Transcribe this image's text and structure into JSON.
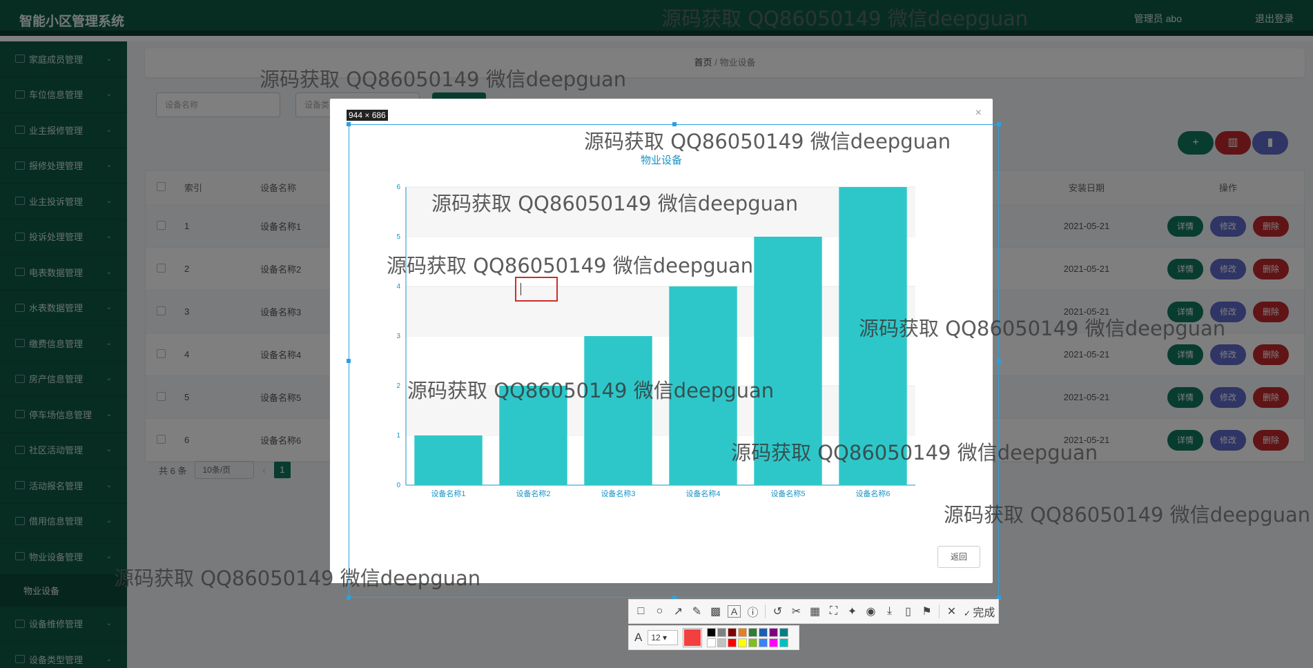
{
  "app": {
    "title": "智能小区管理系统",
    "user": "管理员 abo",
    "logout": "退出登录"
  },
  "sidebar": {
    "items": [
      "家庭成员管理",
      "车位信息管理",
      "业主报修管理",
      "报修处理管理",
      "业主投诉管理",
      "投诉处理管理",
      "电表数据管理",
      "水表数据管理",
      "缴费信息管理",
      "房产信息管理",
      "停车场信息管理",
      "社区活动管理",
      "活动报名管理",
      "借用信息管理",
      "物业设备管理"
    ],
    "sub_item": "物业设备",
    "items_after": [
      "设备维修管理",
      "设备类型管理"
    ]
  },
  "breadcrumb": {
    "home": "首页",
    "sep": "/",
    "current": "物业设备"
  },
  "filters": {
    "name_placeholder": "设备名称",
    "type_placeholder": "设备类"
  },
  "table": {
    "headers": {
      "index": "索引",
      "name": "设备名称",
      "date": "安装日期",
      "ops": "操作"
    },
    "rows": [
      {
        "index": "1",
        "name": "设备名称1",
        "date": "2021-05-21"
      },
      {
        "index": "2",
        "name": "设备名称2",
        "date": "2021-05-21"
      },
      {
        "index": "3",
        "name": "设备名称3",
        "date": "2021-05-21"
      },
      {
        "index": "4",
        "name": "设备名称4",
        "date": "2021-05-21"
      },
      {
        "index": "5",
        "name": "设备名称5",
        "date": "2021-05-21"
      },
      {
        "index": "6",
        "name": "设备名称6",
        "date": "2021-05-21"
      }
    ],
    "actions": {
      "detail": "详情",
      "edit": "修改",
      "delete": "删除"
    },
    "toolbar_icons": [
      "plus-icon",
      "trash-icon",
      "chart-icon"
    ]
  },
  "pagination": {
    "total": "共 6 条",
    "page_size": "10条/页",
    "current_page": "1"
  },
  "dialog": {
    "back_label": "返回",
    "close_glyph": "×"
  },
  "chart_data": {
    "type": "bar",
    "title": "物业设备",
    "categories": [
      "设备名称1",
      "设备名称2",
      "设备名称3",
      "设备名称4",
      "设备名称5",
      "设备名称6"
    ],
    "values": [
      1,
      2,
      3,
      4,
      5,
      6
    ],
    "ylim": [
      0,
      6
    ],
    "yticks": [
      "0",
      "1",
      "2",
      "3",
      "4",
      "5",
      "6"
    ],
    "color": "#2ec7c9",
    "grid": "banded"
  },
  "screenshot_tool": {
    "dimensions": "944 × 686",
    "done_label": "完成",
    "font_size": "12",
    "current_color": "#f24040",
    "palette": [
      "#000000",
      "#808080",
      "#800000",
      "#e67e22",
      "#2e7d32",
      "#1a5fb4",
      "#800080",
      "#008080",
      "#ffffff",
      "#c0c0c0",
      "#ff0000",
      "#ffff00",
      "#7fbf1f",
      "#3b82f6",
      "#ff00ff",
      "#00c0c0"
    ]
  },
  "watermark": "源码获取 QQ86050149 微信deepguan"
}
